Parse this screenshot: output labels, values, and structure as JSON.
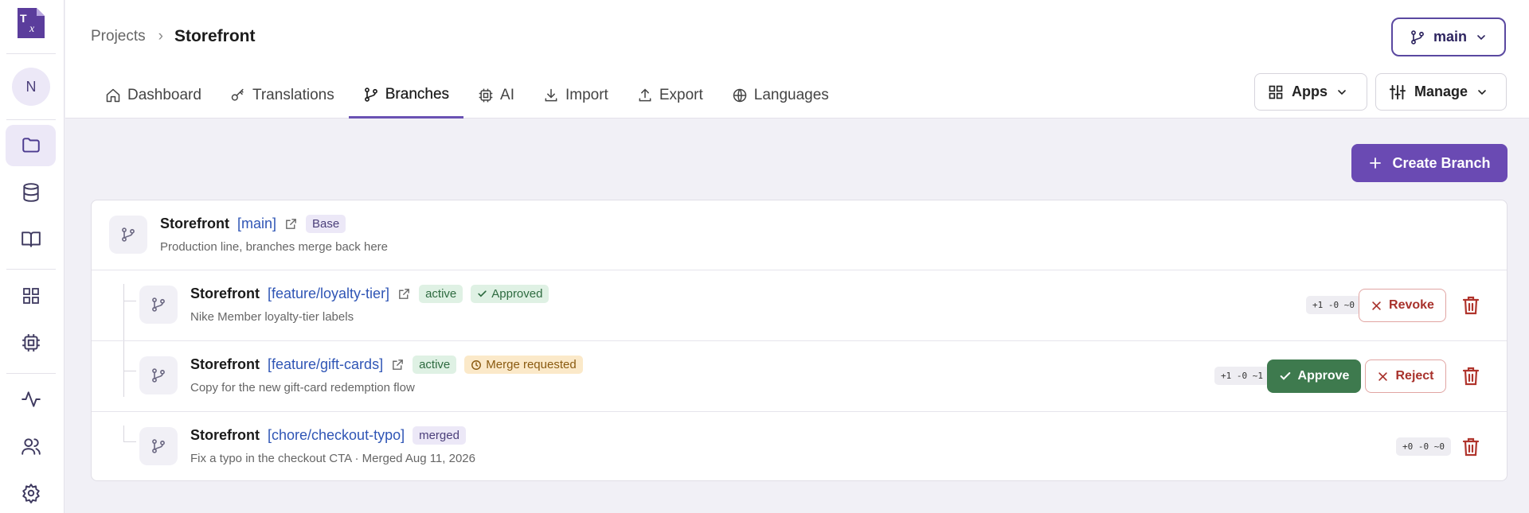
{
  "app": {
    "logo_name": "T x",
    "avatar_initial": "N"
  },
  "breadcrumb": {
    "parent": "Projects",
    "separator": "›",
    "current": "Storefront"
  },
  "branch_selector": {
    "label": "main"
  },
  "tabs": [
    {
      "label": "Dashboard",
      "icon": "home-icon"
    },
    {
      "label": "Translations",
      "icon": "key-icon"
    },
    {
      "label": "Branches",
      "icon": "branch-icon",
      "active": true
    },
    {
      "label": "AI",
      "icon": "chip-icon"
    },
    {
      "label": "Import",
      "icon": "download-icon"
    },
    {
      "label": "Export",
      "icon": "upload-icon"
    },
    {
      "label": "Languages",
      "icon": "globe-icon"
    }
  ],
  "header_buttons": {
    "apps": "Apps",
    "manage": "Manage"
  },
  "create_branch": "Create Branch",
  "branches": [
    {
      "project": "Storefront",
      "branch": "[main]",
      "badges": [
        "Base"
      ],
      "description": "Production line, branches merge back here"
    },
    {
      "project": "Storefront",
      "branch": "[feature/loyalty-tier]",
      "badges": [
        "active",
        "Approved"
      ],
      "description": "Nike Member loyalty-tier labels",
      "diff": "+1 -0 ~0",
      "actions": [
        "Revoke"
      ]
    },
    {
      "project": "Storefront",
      "branch": "[feature/gift-cards]",
      "badges": [
        "active",
        "Merge requested"
      ],
      "description": "Copy for the new gift-card redemption flow",
      "diff": "+1 -0 ~1",
      "actions": [
        "Approve",
        "Reject"
      ]
    },
    {
      "project": "Storefront",
      "branch": "[chore/checkout-typo]",
      "badges": [
        "merged"
      ],
      "description": "Fix a typo in the checkout CTA · Merged Aug 11, 2026",
      "diff": "+0 -0 ~0",
      "actions": []
    }
  ],
  "colors": {
    "accent": "#6a4ab3",
    "branch_link": "#2f55b5",
    "approve": "#3e7a4e",
    "danger": "#a8322c"
  }
}
